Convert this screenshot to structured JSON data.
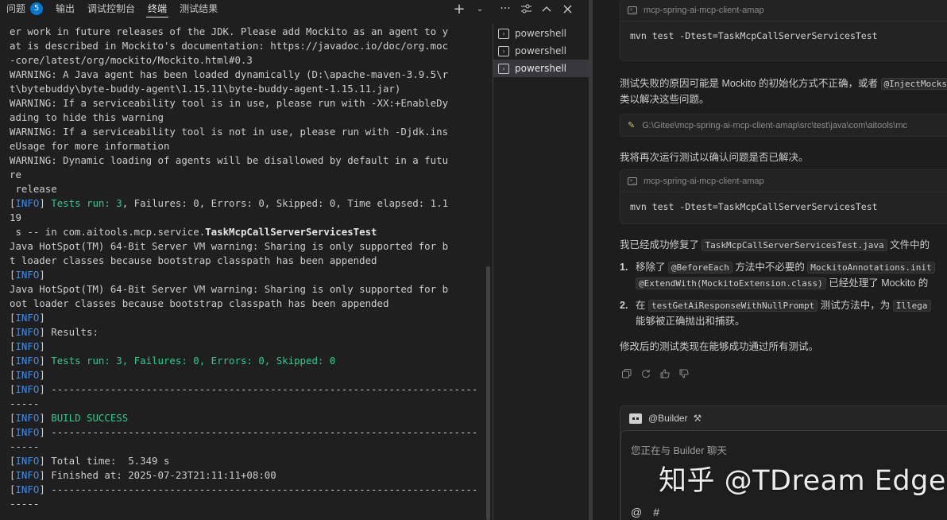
{
  "panel": {
    "tabs": [
      {
        "label": "问题",
        "badge": "5"
      },
      {
        "label": "输出"
      },
      {
        "label": "调试控制台"
      },
      {
        "label": "终端"
      },
      {
        "label": "测试结果"
      }
    ],
    "tool_icons": [
      "plus-icon",
      "chevron-down-icon",
      "more-icon",
      "terminal-settings-icon",
      "chevron-up-icon",
      "close-icon"
    ]
  },
  "terminal": {
    "lines": [
      [
        "er work in future releases of the JDK. Please add Mockito as an agent to y"
      ],
      [
        "at is described in Mockito's documentation: https://javadoc.io/doc/org.moc"
      ],
      [
        "-core/latest/org/mockito/Mockito.html#0.3"
      ],
      [
        "WARNING: A Java agent has been loaded dynamically (D:\\apache-maven-3.9.5\\r"
      ],
      [
        "t\\bytebuddy\\byte-buddy-agent\\1.15.11\\byte-buddy-agent-1.15.11.jar)"
      ],
      [
        "WARNING: If a serviceability tool is in use, please run with -XX:+EnableDy"
      ],
      [
        "ading to hide this warning"
      ],
      [
        "WARNING: If a serviceability tool is not in use, please run with -Djdk.ins"
      ],
      [
        "eUsage for more information"
      ],
      [
        "WARNING: Dynamic loading of agents will be disallowed by default in a futu"
      ],
      [
        "re"
      ],
      [
        " release"
      ],
      [
        "[",
        "INFO",
        "] ",
        "Tests run: 3",
        ", Failures: 0, Errors: 0, Skipped: 0, Time elapsed: 1.1"
      ],
      [
        "19"
      ],
      [
        " s -- in com.aitools.mcp.service.",
        "TaskMcpCallServerServicesTest"
      ],
      [
        "Java HotSpot(TM) 64-Bit Server VM warning: Sharing is only supported for b"
      ],
      [
        "t loader classes because bootstrap classpath has been appended"
      ],
      [
        "[",
        "INFO",
        "]"
      ],
      [
        "Java HotSpot(TM) 64-Bit Server VM warning: Sharing is only supported for b"
      ],
      [
        "oot loader classes because bootstrap classpath has been appended"
      ],
      [
        "[",
        "INFO",
        "]"
      ],
      [
        "[",
        "INFO",
        "] Results:"
      ],
      [
        "[",
        "INFO",
        "]"
      ],
      [
        "[",
        "INFO",
        "] ",
        "Tests run: 3, Failures: 0, Errors: 0, Skipped: 0"
      ],
      [
        "[",
        "INFO",
        "]"
      ],
      [
        "[",
        "INFO",
        "] ------------------------------------------------------------------------"
      ],
      [
        "-----"
      ],
      [
        "[",
        "INFO",
        "] ",
        "BUILD SUCCESS"
      ],
      [
        "[",
        "INFO",
        "] ------------------------------------------------------------------------"
      ],
      [
        "-----"
      ],
      [
        "[",
        "INFO",
        "] Total time:  5.349 s"
      ],
      [
        "[",
        "INFO",
        "] Finished at: 2025-07-23T21:11:11+08:00"
      ],
      [
        "[",
        "INFO",
        "] ------------------------------------------------------------------------"
      ],
      [
        "-----"
      ]
    ],
    "line_styles": [
      [],
      [],
      [],
      [],
      [],
      [],
      [],
      [],
      [],
      [],
      [],
      [],
      [
        "brk",
        "lvl",
        "brk",
        "grn",
        ""
      ],
      [],
      [
        "",
        "bld"
      ],
      [],
      [],
      [
        "brk",
        "lvl",
        "brk"
      ],
      [],
      [],
      [
        "brk",
        "lvl",
        "brk"
      ],
      [
        "brk",
        "lvl",
        ""
      ],
      [
        "brk",
        "lvl",
        "brk"
      ],
      [
        "brk",
        "lvl",
        "",
        "grn"
      ],
      [
        "brk",
        "lvl",
        "brk"
      ],
      [
        "brk",
        "lvl",
        ""
      ],
      [],
      [
        "brk",
        "lvl",
        "",
        "grn"
      ],
      [
        "brk",
        "lvl",
        ""
      ],
      [],
      [
        "brk",
        "lvl",
        ""
      ],
      [
        "brk",
        "lvl",
        ""
      ],
      [
        "brk",
        "lvl",
        ""
      ],
      []
    ]
  },
  "shells": [
    {
      "label": "powershell",
      "active": false
    },
    {
      "label": "powershell",
      "active": false
    },
    {
      "label": "powershell",
      "active": true
    }
  ],
  "chat": {
    "card1": {
      "header": "mcp-spring-ai-mcp-client-amap",
      "command": "mvn test -Dtest=TaskMcpCallServerServicesTest"
    },
    "text1": {
      "pre": "测试失败的原因可能是 Mockito 的初始化方式不正确，或者 ",
      "code": "@InjectMocks"
    },
    "text1b": "类以解决这些问题。",
    "file_path": "G:\\Gitee\\mcp-spring-ai-mcp-client-amap\\src\\test\\java\\com\\aitools\\mc",
    "text2": "我将再次运行测试以确认问题是否已解决。",
    "card2": {
      "header": "mcp-spring-ai-mcp-client-amap",
      "command": "mvn test -Dtest=TaskMcpCallServerServicesTest"
    },
    "text3": {
      "pre": "我已经成功修复了 ",
      "code": "TaskMcpCallServerServicesTest.java",
      "post": " 文件中的"
    },
    "list": [
      {
        "num": "1.",
        "pre": "移除了 ",
        "code1": "@BeforeEach",
        "mid": " 方法中不必要的 ",
        "code2": "MockitoAnnotations.init"
      },
      {
        "num": "2.",
        "pre": "在 ",
        "code1": "testGetAiResponseWithNullPrompt",
        "mid": " 测试方法中，为 ",
        "code2": "Illega"
      }
    ],
    "list1_cont": {
      "code": "@ExtendWith(MockitoExtension.class)",
      "post": " 已经处理了 Mockito 的"
    },
    "list2_cont": "能够被正确抛出和捕获。",
    "text4": "修改后的测试类现在能够成功通过所有测试。",
    "action_icons": [
      "copy-icon",
      "retry-icon",
      "thumbs-up-icon",
      "thumbs-down-icon"
    ],
    "builder": {
      "name": "@Builder",
      "placeholder": "您正在与 Builder 聊天",
      "at": "@",
      "hash": "#"
    }
  },
  "watermark": "知乎 @TDream Edge"
}
